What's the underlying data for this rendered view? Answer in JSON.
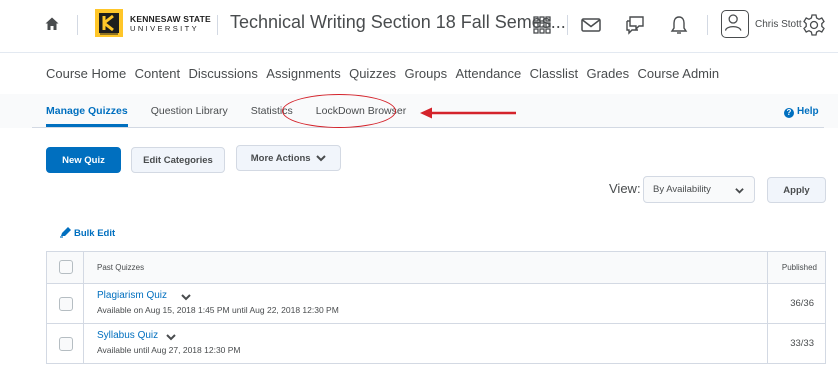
{
  "header": {
    "logo_line1": "KENNESAW STATE",
    "logo_line2": "UNIVERSITY",
    "course_title": "Technical Writing Section 18 Fall Semes...",
    "user_name": "Chris Stott",
    "icons": [
      "home-icon",
      "waffle-grid-icon",
      "mail-icon",
      "chat-icon",
      "bell-icon",
      "user-avatar-icon",
      "gear-icon"
    ]
  },
  "course_nav": {
    "items": [
      "Course Home",
      "Content",
      "Discussions",
      "Assignments",
      "Quizzes",
      "Groups",
      "Attendance",
      "Classlist",
      "Grades",
      "Course Admin"
    ]
  },
  "subtabs": {
    "items": [
      "Manage Quizzes",
      "Question Library",
      "Statistics",
      "LockDown Browser"
    ],
    "active": "Manage Quizzes",
    "help": "Help"
  },
  "toolbar": {
    "new_quiz": "New Quiz",
    "edit_categories": "Edit Categories",
    "more_actions": "More Actions"
  },
  "view": {
    "label": "View:",
    "selected": "By Availability",
    "apply": "Apply"
  },
  "bulk_edit": "Bulk Edit",
  "table": {
    "section_header": "Past Quizzes",
    "published_header": "Published",
    "rows": [
      {
        "name": "Plagiarism Quiz",
        "availability": "Available on Aug 15, 2018 1:45 PM until Aug 22, 2018 12:30 PM",
        "published": "36/36"
      },
      {
        "name": "Syllabus Quiz",
        "availability": "Available until Aug 27, 2018 12:30 PM",
        "published": "33/33"
      }
    ]
  },
  "colors": {
    "accent": "#006fbf",
    "text": "#494c4e",
    "border": "#d3d9e3",
    "annotation": "#d4232b",
    "logo_gold": "#ffc629"
  }
}
